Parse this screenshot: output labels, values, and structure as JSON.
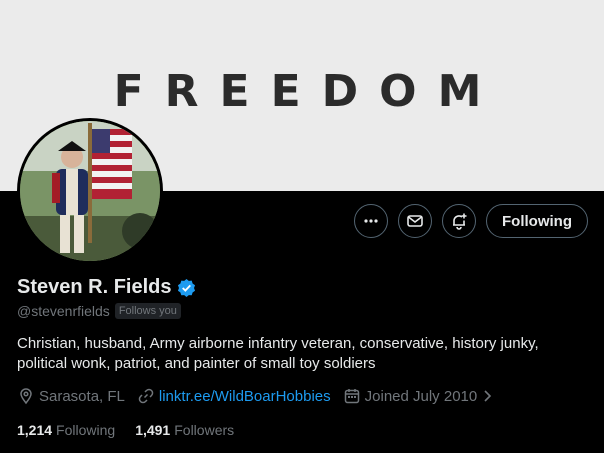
{
  "banner": {
    "text": "FREEDOM",
    "background": "#ebebeb",
    "text_color": "#2b2b2b"
  },
  "actions": {
    "more_icon": "more-icon",
    "message_icon": "envelope-icon",
    "notify_icon": "bell-plus-icon",
    "following_label": "Following"
  },
  "profile": {
    "name": "Steven R. Fields",
    "verified_icon": "verified-badge-icon",
    "handle": "@stevenrfields",
    "follows_you": "Follows you",
    "bio": "Christian, husband, Army airborne infantry veteran, conservative, history junky, political wonk, patriot, and painter of small toy soldiers",
    "location": "Sarasota, FL",
    "link": "linktr.ee/WildBoarHobbies",
    "joined": "Joined July 2010"
  },
  "stats": {
    "following_count": "1,214",
    "following_label": "Following",
    "followers_count": "1,491",
    "followers_label": "Followers"
  },
  "colors": {
    "accent": "#1d9bf0",
    "muted": "#71767b",
    "text": "#e7e9ea",
    "background": "#000000"
  }
}
